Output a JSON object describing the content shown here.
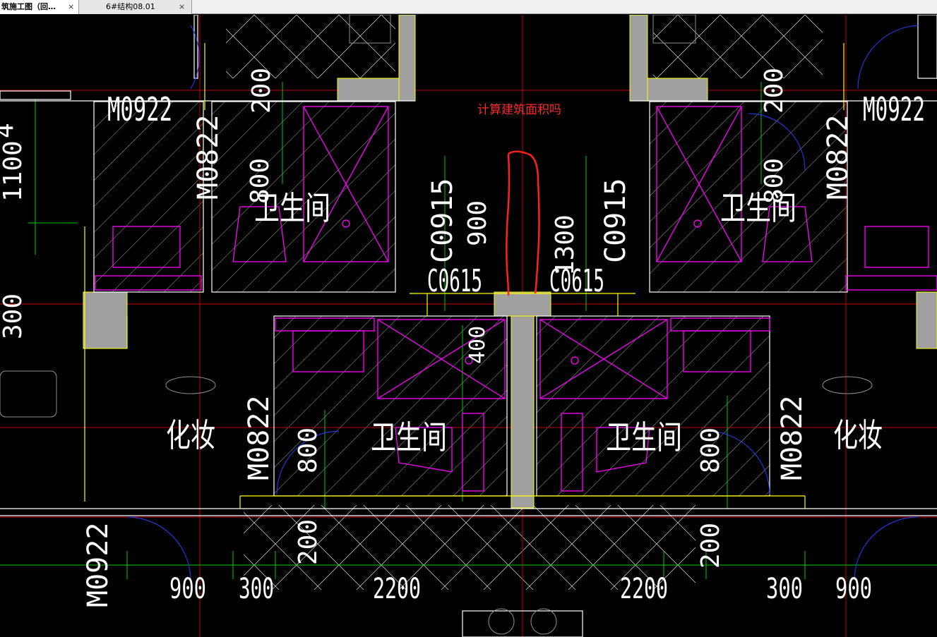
{
  "tabs": [
    {
      "label": "筑施工图（回…",
      "close": "×"
    },
    {
      "label": "6#结构08.01",
      "close": "×"
    }
  ],
  "annotation": {
    "text": "计算建筑面积吗",
    "color": "#ff2a2a"
  },
  "drawing": {
    "room_labels": {
      "bathroom": "卫生间",
      "dressing": "化妆"
    },
    "door_tags": {
      "m0922": "M0922",
      "m0822": "M0822"
    },
    "window_tags": {
      "c0915": "C0915",
      "c0615": "C0615"
    },
    "dims": {
      "d200": "200",
      "d800": "800",
      "d900": "900",
      "d1300": "1300",
      "d300": "300",
      "d2200": "2200",
      "d1100": "1100",
      "d4": "4",
      "d400": "400"
    },
    "colors": {
      "wall": "#a0a0a0",
      "fixture": "#ff00ff",
      "dim": "#00cc00",
      "axis": "#c00000",
      "outline": "#ffffff",
      "yellow": "#ffff00"
    }
  }
}
